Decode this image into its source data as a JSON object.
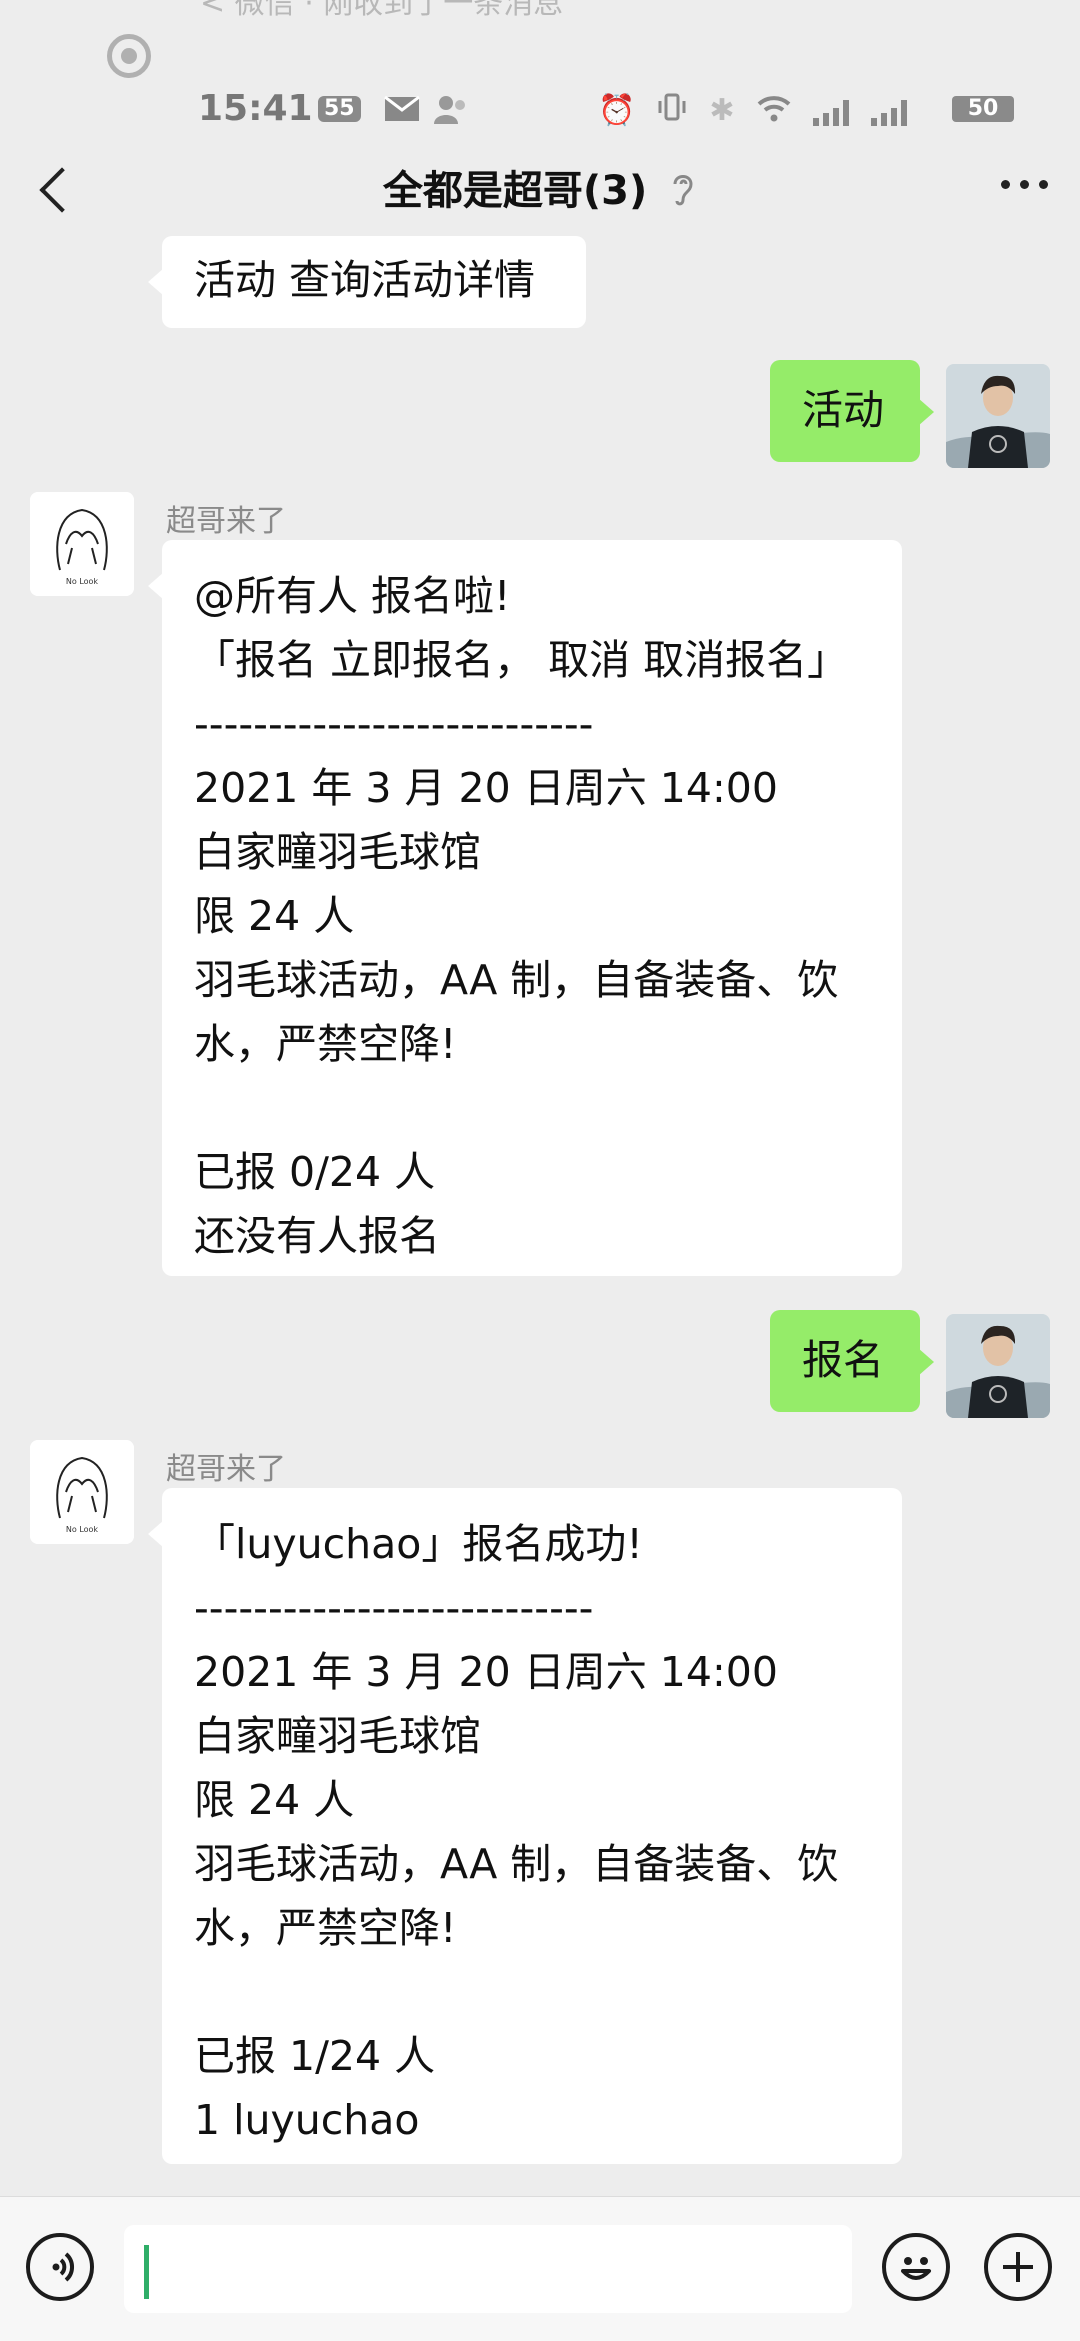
{
  "statusbar": {
    "ghost_text": "< 微信 · 刚收到了一条消息",
    "time": "15:41",
    "badge_left": "55",
    "battery": "50"
  },
  "header": {
    "title": "全都是超哥(3)"
  },
  "messages": [
    {
      "sender": "",
      "lines": [
        "活动 查询活动详情"
      ]
    },
    {
      "sender": "me",
      "lines": [
        "活动"
      ]
    },
    {
      "sender": "超哥来了",
      "lines": [
        "@所有人 报名啦!",
        "「报名 立即报名， 取消 取消报名」",
        "---------------------------",
        "2021 年 3 月 20 日周六 14:00",
        "白家疃羽毛球馆",
        "限 24 人",
        "羽毛球活动，AA 制，自备装备、饮",
        "水，严禁空降!",
        "",
        "已报 0/24 人",
        "还没有人报名"
      ]
    },
    {
      "sender": "me",
      "lines": [
        "报名"
      ]
    },
    {
      "sender": "超哥来了",
      "lines": [
        "「luyuchao」报名成功!",
        "---------------------------",
        "2021 年 3 月 20 日周六 14:00",
        "白家疃羽毛球馆",
        "限 24 人",
        "羽毛球活动，AA 制，自备装备、饮",
        "水，严禁空降!",
        "",
        "已报 1/24 人",
        "1 luyuchao"
      ]
    }
  ],
  "avatars": {
    "bot_caption": "No Look"
  },
  "icons": {
    "back": "chevron-left-icon",
    "mute": "ear-icon",
    "more": "more-dots-icon",
    "voice": "voice-icon",
    "emoji": "emoji-icon",
    "add": "plus-icon"
  },
  "colors": {
    "background": "#ededed",
    "bubble_self": "#95ec69",
    "bubble_other": "#ffffff",
    "caret": "#2fae68"
  }
}
